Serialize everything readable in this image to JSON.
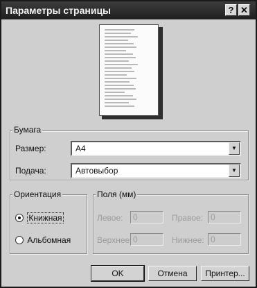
{
  "window": {
    "title": "Параметры страницы",
    "help_label": "?",
    "close_label": "✕"
  },
  "paper": {
    "group_label": "Бумага",
    "size_label": "Размер:",
    "size_value": "A4",
    "feed_label": "Подача:",
    "feed_value": "Автовыбор"
  },
  "orientation": {
    "group_label": "Ориентация",
    "portrait_label": "Книжная",
    "landscape_label": "Альбомная",
    "selected": "portrait"
  },
  "margins": {
    "group_label": "Поля (мм)",
    "left_label": "Левое:",
    "left_value": "0",
    "right_label": "Правое:",
    "right_value": "0",
    "top_label": "Верхнее:",
    "top_value": "0",
    "bottom_label": "Нижнее:",
    "bottom_value": "0"
  },
  "buttons": {
    "ok": "OK",
    "cancel": "Отмена",
    "printer": "Принтер..."
  }
}
